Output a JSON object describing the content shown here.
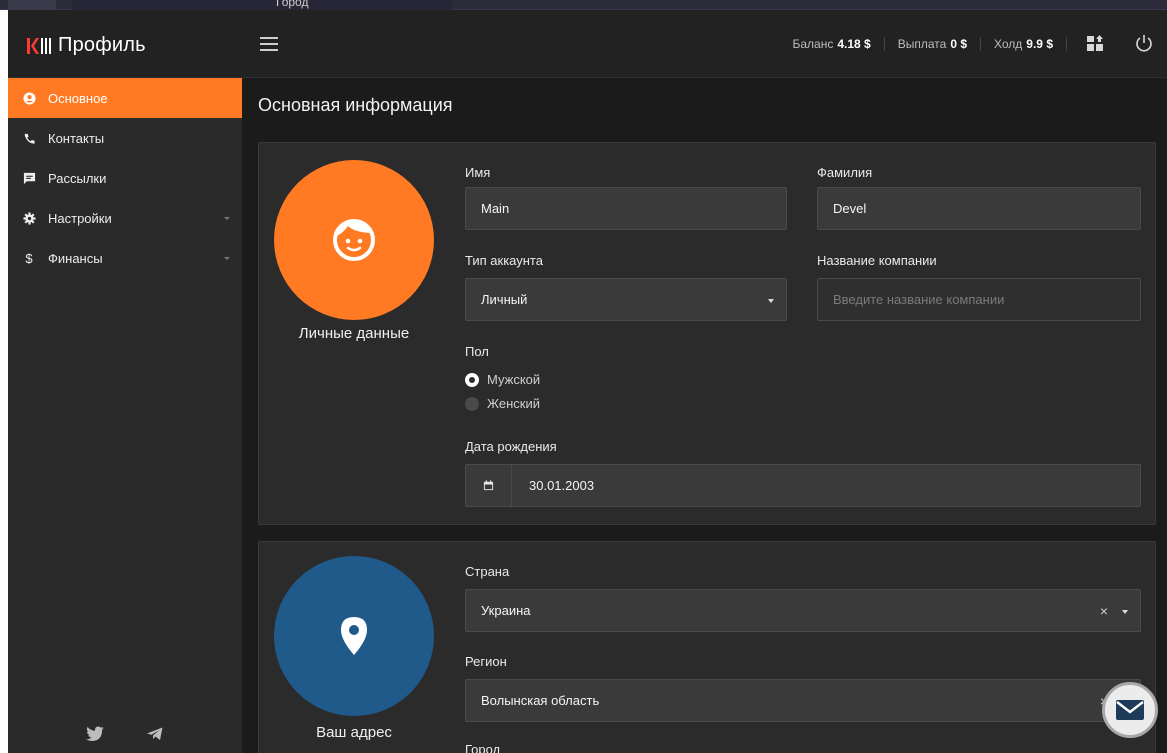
{
  "overlay": {
    "top_text": "Город"
  },
  "header": {
    "title": "Профиль",
    "stats": [
      {
        "label": "Баланс",
        "value": "4.18 $"
      },
      {
        "label": "Выплата",
        "value": "0 $"
      },
      {
        "label": "Холд",
        "value": "9.9 $"
      }
    ]
  },
  "sidebar": {
    "items": [
      {
        "label": "Основное",
        "icon": "user-circle-icon"
      },
      {
        "label": "Контакты",
        "icon": "phone-icon"
      },
      {
        "label": "Рассылки",
        "icon": "message-icon"
      },
      {
        "label": "Настройки",
        "icon": "gear-icon"
      },
      {
        "label": "Финансы",
        "icon": "dollar-icon"
      }
    ]
  },
  "main": {
    "title": "Основная информация",
    "personal": {
      "section_label": "Личные данные",
      "first_name_label": "Имя",
      "first_name": "Main",
      "last_name_label": "Фамилия",
      "last_name": "Devel",
      "account_type_label": "Тип аккаунта",
      "account_type": "Личный",
      "company_label": "Название компании",
      "company_placeholder": "Введите название компании",
      "gender_label": "Пол",
      "gender_male": "Мужской",
      "gender_female": "Женский",
      "birthdate_label": "Дата рождения",
      "birthdate": "30.01.2003"
    },
    "address": {
      "section_label": "Ваш адрес",
      "country_label": "Страна",
      "country": "Украина",
      "region_label": "Регион",
      "region": "Волынская область",
      "city_label": "Город"
    }
  },
  "colors": {
    "accent": "#ff7a22",
    "address_blue": "#1f5a8a"
  }
}
